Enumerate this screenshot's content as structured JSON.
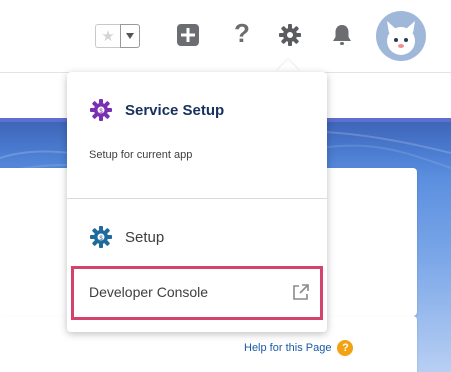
{
  "header": {
    "favorites": {
      "star_icon": "star-icon",
      "dropdown_icon": "chevron-down-icon"
    },
    "icons": [
      "plus-icon",
      "help-icon",
      "gear-icon",
      "bell-icon"
    ],
    "help_glyph": "?",
    "avatar": "avatar"
  },
  "setup_menu": {
    "service_setup": {
      "label": "Service Setup",
      "subtitle": "Setup for current app",
      "icon": "gear-icon",
      "icon_color": "#7b2fb2"
    },
    "setup": {
      "label": "Setup",
      "icon": "gear-icon",
      "icon_color": "#1f6a9c"
    },
    "developer_console": {
      "label": "Developer Console",
      "icon": "external-link-icon",
      "highlight_color": "#d4436b"
    }
  },
  "page": {
    "help_link": "Help for this Page",
    "help_icon_glyph": "?"
  }
}
